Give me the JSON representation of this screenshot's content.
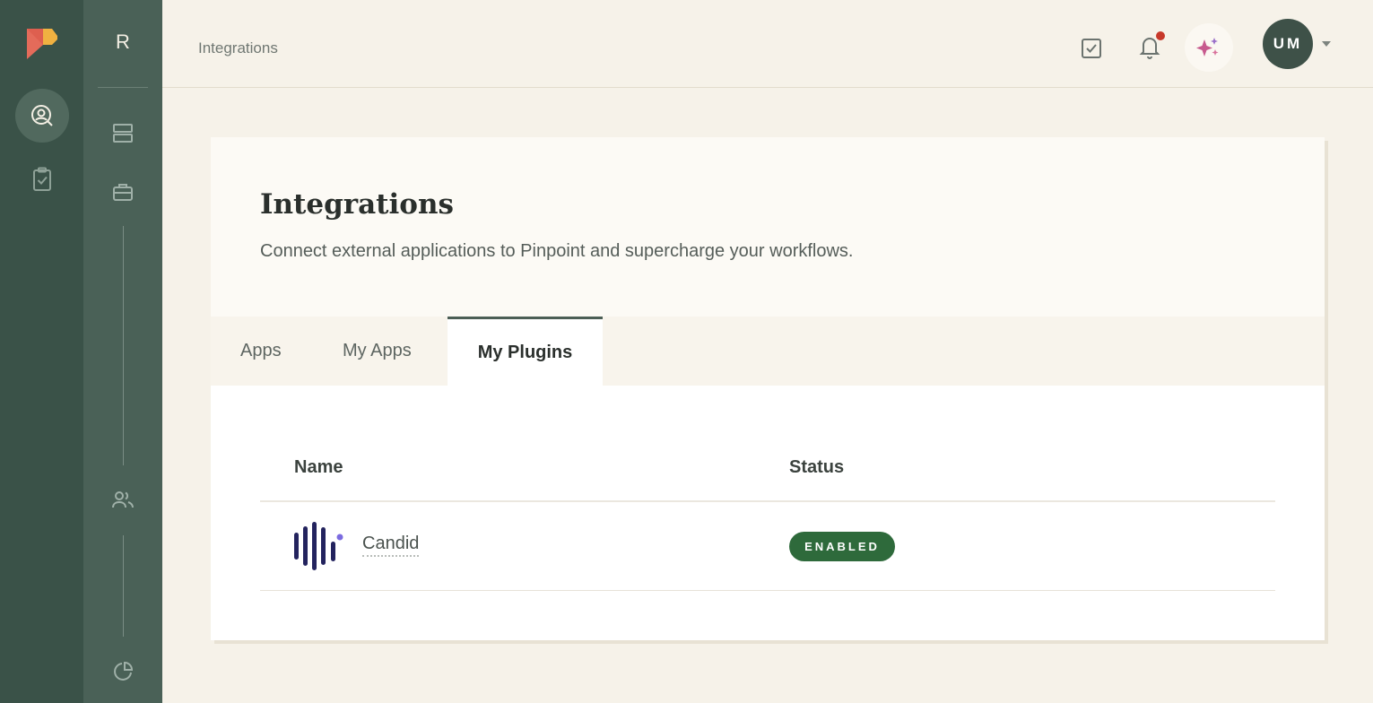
{
  "app": {
    "workspace_initial": "R"
  },
  "topbar": {
    "breadcrumb": "Integrations",
    "avatar_initials": "UM"
  },
  "page": {
    "title": "Integrations",
    "subtitle": "Connect external applications to Pinpoint and supercharge your workflows.",
    "tabs": [
      {
        "label": "Apps"
      },
      {
        "label": "My Apps"
      },
      {
        "label": "My Plugins",
        "active": true
      }
    ]
  },
  "table": {
    "columns": [
      "Name",
      "Status"
    ],
    "rows": [
      {
        "name": "Candid",
        "status": "ENABLED",
        "icon": "candid-logo"
      }
    ]
  },
  "colors": {
    "rail_dark": "#3a5248",
    "rail_mid": "#4a6157",
    "status_enabled": "#2e6a3b",
    "notification_dot": "#c7392a"
  }
}
